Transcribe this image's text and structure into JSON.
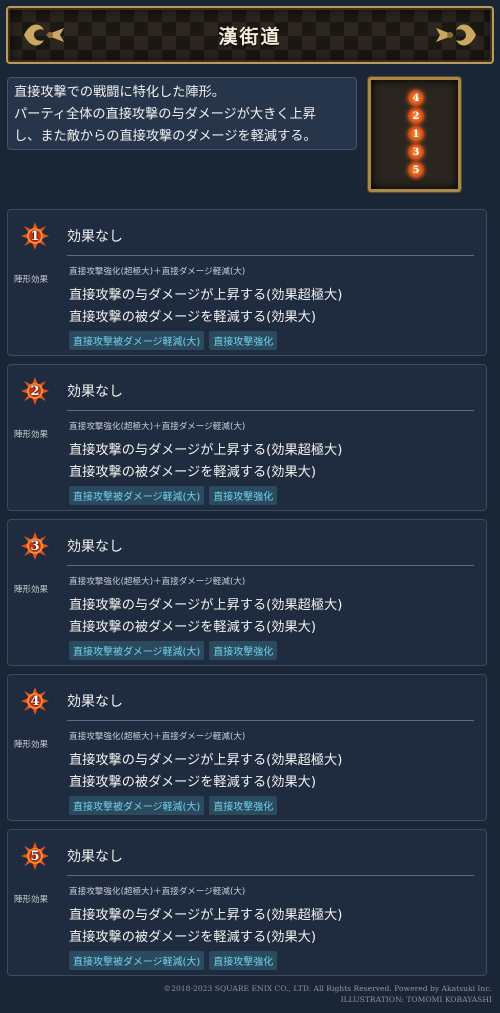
{
  "header": {
    "title": "漢街道"
  },
  "description": {
    "line1": "直接攻撃での戦闘に特化した陣形。",
    "line2": "パーティ全体の直接攻撃の与ダメージが大きく上昇",
    "line3": "し、また敵からの直接攻撃のダメージを軽減する。"
  },
  "formation": {
    "slots": [
      "4",
      "2",
      "1",
      "3",
      "5"
    ]
  },
  "cards": [
    {
      "number": "1",
      "status": "効果なし",
      "side_label": "陣形効果",
      "summary": "直接攻撃強化(超極大)＋直接ダメージ軽減(大)",
      "line1": "直接攻撃の与ダメージが上昇する(効果超極大)",
      "line2": "直接攻撃の被ダメージを軽減する(効果大)",
      "tags": [
        "直接攻撃被ダメージ軽減(大)",
        "直接攻撃強化"
      ]
    },
    {
      "number": "2",
      "status": "効果なし",
      "side_label": "陣形効果",
      "summary": "直接攻撃強化(超極大)＋直接ダメージ軽減(大)",
      "line1": "直接攻撃の与ダメージが上昇する(効果超極大)",
      "line2": "直接攻撃の被ダメージを軽減する(効果大)",
      "tags": [
        "直接攻撃被ダメージ軽減(大)",
        "直接攻撃強化"
      ]
    },
    {
      "number": "3",
      "status": "効果なし",
      "side_label": "陣形効果",
      "summary": "直接攻撃強化(超極大)＋直接ダメージ軽減(大)",
      "line1": "直接攻撃の与ダメージが上昇する(効果超極大)",
      "line2": "直接攻撃の被ダメージを軽減する(効果大)",
      "tags": [
        "直接攻撃被ダメージ軽減(大)",
        "直接攻撃強化"
      ]
    },
    {
      "number": "4",
      "status": "効果なし",
      "side_label": "陣形効果",
      "summary": "直接攻撃強化(超極大)＋直接ダメージ軽減(大)",
      "line1": "直接攻撃の与ダメージが上昇する(効果超極大)",
      "line2": "直接攻撃の被ダメージを軽減する(効果大)",
      "tags": [
        "直接攻撃被ダメージ軽減(大)",
        "直接攻撃強化"
      ]
    },
    {
      "number": "5",
      "status": "効果なし",
      "side_label": "陣形効果",
      "summary": "直接攻撃強化(超極大)＋直接ダメージ軽減(大)",
      "line1": "直接攻撃の与ダメージが上昇する(効果超極大)",
      "line2": "直接攻撃の被ダメージを軽減する(効果大)",
      "tags": [
        "直接攻撃被ダメージ軽減(大)",
        "直接攻撃強化"
      ]
    }
  ],
  "footer": {
    "copyright": "©2018-2023 SQUARE ENIX CO., LTD. All Rights Reserved. Powered by Akatsuki Inc.",
    "illustration": "ILLUSTRATION: TOMOMI KOBAYASHI"
  },
  "colors": {
    "background": "#1a2536",
    "accent_gold": "#b89a5a",
    "tag_text": "#6fd3ee",
    "badge_fire": "#d24c1a"
  },
  "icons": {
    "slot_badge": "fire-burst-icon",
    "header_ornament": "fleur-ornament-icon"
  }
}
